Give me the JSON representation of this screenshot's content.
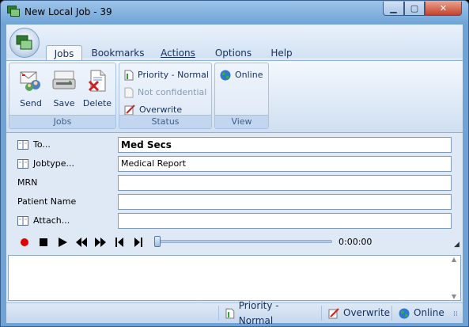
{
  "window": {
    "title": "New Local Job - 39",
    "controls": {
      "minimize": "minimize-icon",
      "maximize": "maximize-icon",
      "close": "close-icon"
    }
  },
  "ribbon": {
    "tabs": [
      {
        "label": "Jobs",
        "active": true
      },
      {
        "label": "Bookmarks",
        "active": false
      },
      {
        "label": "Actions",
        "active": false
      },
      {
        "label": "Options",
        "active": false
      },
      {
        "label": "Help",
        "active": false
      }
    ],
    "groups": {
      "jobs": {
        "label": "Jobs",
        "buttons": [
          {
            "label": "Send",
            "icon": "send-icon"
          },
          {
            "label": "Save",
            "icon": "save-icon"
          },
          {
            "label": "Delete",
            "icon": "delete-icon"
          }
        ]
      },
      "status": {
        "label": "Status",
        "items": [
          {
            "label": "Priority - Normal",
            "icon": "priority-icon",
            "enabled": true
          },
          {
            "label": "Not confidential",
            "icon": "document-icon",
            "enabled": false
          },
          {
            "label": "Overwrite",
            "icon": "overwrite-icon",
            "enabled": true
          }
        ]
      },
      "view": {
        "label": "View",
        "items": [
          {
            "label": "Online",
            "icon": "globe-icon",
            "enabled": true
          }
        ]
      }
    }
  },
  "form": {
    "to": {
      "label": "To...",
      "value": "Med Secs"
    },
    "jobtype": {
      "label": "Jobtype...",
      "value": "Medical Report"
    },
    "mrn": {
      "label": "MRN",
      "value": ""
    },
    "patient_name": {
      "label": "Patient Name",
      "value": ""
    },
    "attach": {
      "label": "Attach...",
      "value": ""
    }
  },
  "transport": {
    "time": "0:00:00",
    "position": 0
  },
  "statusbar": {
    "priority": "Priority - Normal",
    "overwrite": "Overwrite",
    "online": "Online"
  },
  "colors": {
    "accent": "#15305b",
    "record": "#e00000",
    "window_frame": "#6fa3d6"
  }
}
